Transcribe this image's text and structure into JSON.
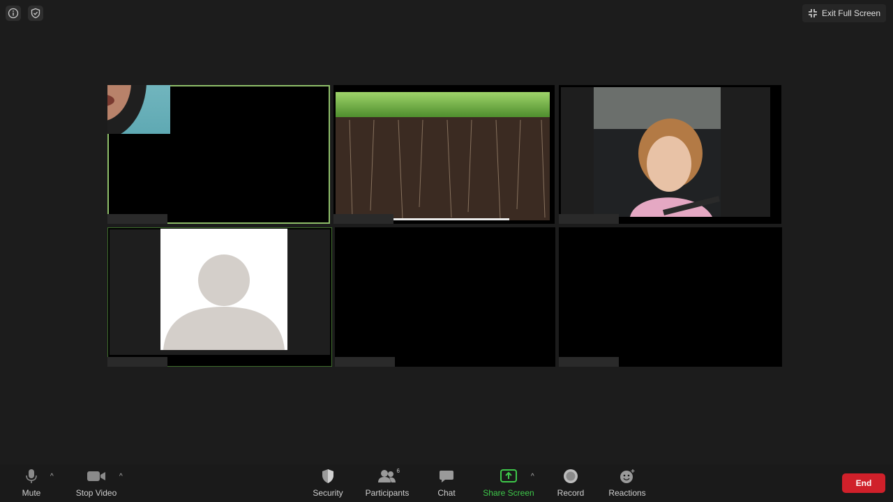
{
  "header": {
    "exit_full_screen": "Exit Full Screen"
  },
  "toolbar": {
    "mute": "Mute",
    "stop_video": "Stop Video",
    "security": "Security",
    "participants": "Participants",
    "participants_count": "6",
    "chat": "Chat",
    "share_screen": "Share Screen",
    "record": "Record",
    "reactions": "Reactions",
    "end": "End"
  },
  "colors": {
    "active_speaker_border": "#8fbf6a",
    "share_screen": "#3ec94a",
    "end_button": "#d0202a"
  }
}
